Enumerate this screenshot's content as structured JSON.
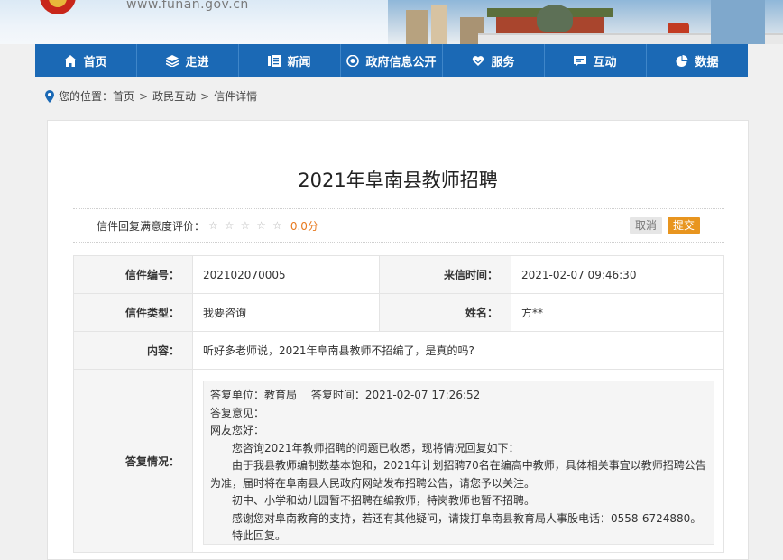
{
  "header": {
    "url": "www.funan.gov.cn"
  },
  "nav": [
    {
      "label": "首页",
      "icon": "home-icon"
    },
    {
      "label": "走进",
      "icon": "layers-icon"
    },
    {
      "label": "新闻",
      "icon": "newspaper-icon"
    },
    {
      "label": "政府信息公开",
      "icon": "eye-icon"
    },
    {
      "label": "服务",
      "icon": "heart-hand-icon"
    },
    {
      "label": "互动",
      "icon": "chat-icon"
    },
    {
      "label": "数据",
      "icon": "pie-chart-icon"
    }
  ],
  "breadcrumb": {
    "prefix": "您的位置：",
    "items": [
      "首页",
      "政民互动",
      "信件详情"
    ],
    "sep": ">"
  },
  "letter": {
    "title": "2021年阜南县教师招聘",
    "rating_label": "信件回复满意度评价：",
    "stars": "☆☆☆☆☆",
    "score": "0.0分",
    "cancel": "取消",
    "submit": "提交",
    "fields": {
      "number_label": "信件编号：",
      "number": "202102070005",
      "time_label": "来信时间：",
      "time": "2021-02-07 09:46:30",
      "type_label": "信件类型：",
      "type": "我要咨询",
      "name_label": "姓名：",
      "name": "方**",
      "content_label": "内容：",
      "content": "听好多老师说，2021年阜南县教师不招编了，是真的吗?",
      "reply_label": "答复情况："
    },
    "reply": {
      "unit_line": "答复单位：教育局　 答复时间：2021-02-07 17:26:52",
      "opinion": "答复意见：",
      "greeting": "网友您好：",
      "p1": "您咨询2021年教师招聘的问题已收悉，现将情况回复如下：",
      "p2": "由于我县教师编制数基本饱和，2021年计划招聘70名在编高中教师，具体相关事宜以教师招聘公告为准，届时将在阜南县人民政府网站发布招聘公告，请您予以关注。",
      "p3": "初中、小学和幼儿园暂不招聘在编教师，特岗教师也暂不招聘。",
      "p4": "感谢您对阜南教育的支持，若还有其他疑问，请拨打阜南县教育局人事股电话：0558-6724880。",
      "p5": "特此回复。"
    }
  }
}
